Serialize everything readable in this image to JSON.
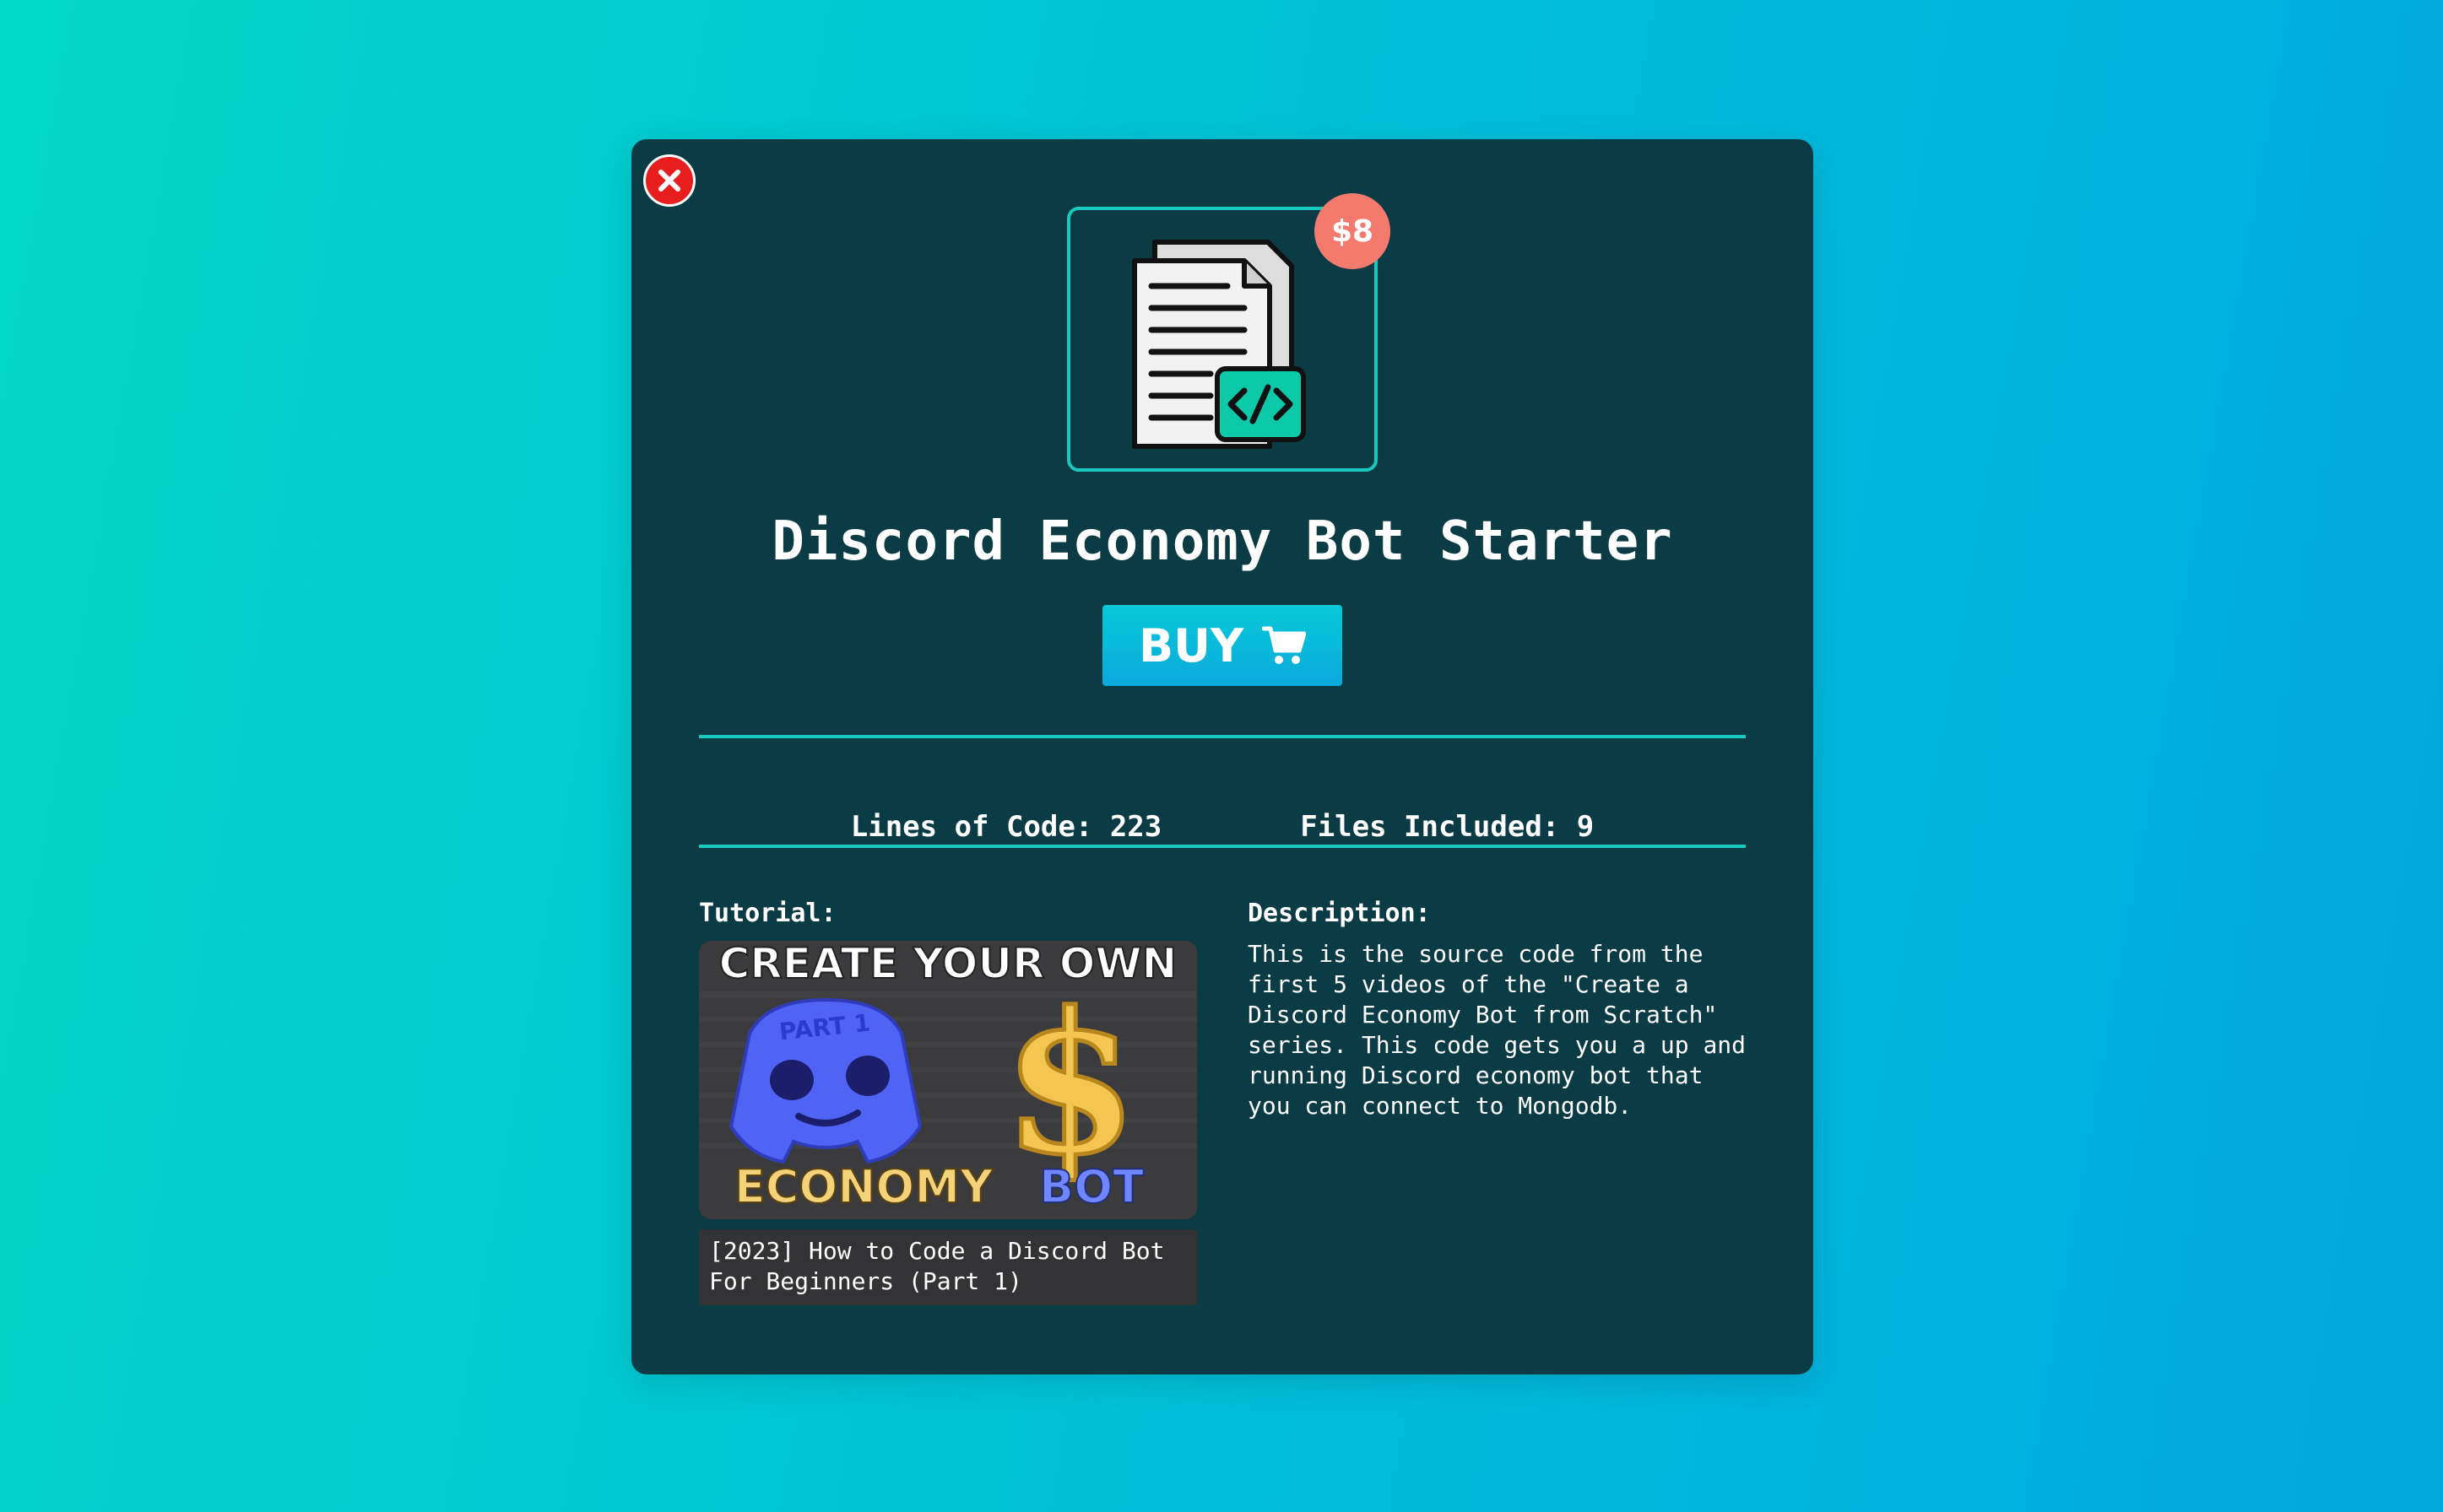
{
  "modal": {
    "title": "Discord Economy Bot Starter",
    "price": "$8",
    "buy_label": "BUY",
    "stats": {
      "lines_label": "Lines of Code:",
      "lines_value": "223",
      "files_label": "Files Included:",
      "files_value": "9"
    },
    "tutorial": {
      "label": "Tutorial:",
      "thumbnail_text": {
        "top": "CREATE YOUR OWN",
        "badge": "PART 1",
        "left": "ECONOMY",
        "right": "BOT"
      },
      "caption": "[2023] How to Code a Discord Bot For Beginners (Part 1)"
    },
    "description": {
      "label": "Description:",
      "text": "This is the source code from the first 5 videos of the \"Create a Discord Economy Bot from Scratch\" series. This code gets you a up and running Discord economy bot that you can connect to Mongodb."
    }
  },
  "icons": {
    "close": "close-icon",
    "product": "code-document-icon",
    "cart": "cart-icon"
  },
  "colors": {
    "modal_bg": "#0b3b44",
    "accent": "#19c9bd",
    "buy_button": "#0aa9dc",
    "price_badge": "#f47a6d",
    "close": "#e81e1e"
  }
}
